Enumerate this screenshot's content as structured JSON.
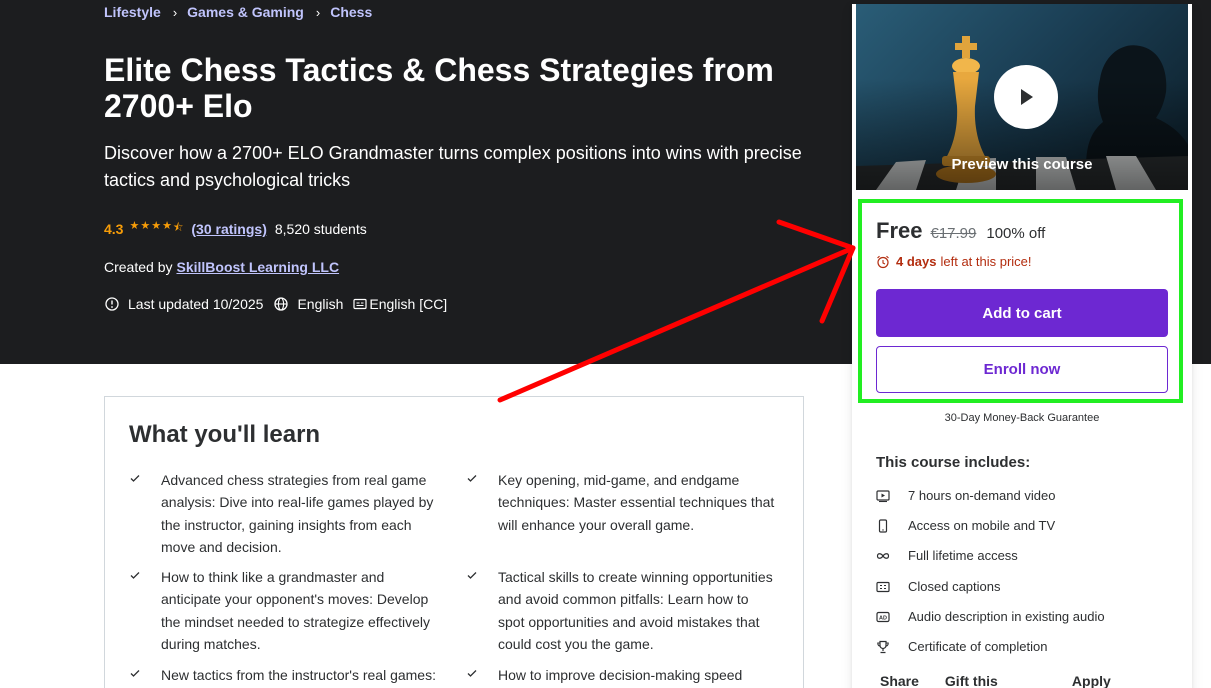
{
  "breadcrumb": {
    "items": [
      "Lifestyle",
      "Games & Gaming",
      "Chess"
    ]
  },
  "course": {
    "title": "Elite Chess Tactics & Chess Strategies from 2700+ Elo",
    "subtitle": "Discover how a 2700+ ELO Grandmaster turns complex positions into wins with precise tactics and psychological tricks",
    "rating": "4.3",
    "stars": 4.3,
    "ratings_count": "(30 ratings)",
    "students": "8,520 students",
    "created_by_prefix": "Created by",
    "author": "SkillBoost Learning LLC",
    "last_updated": "Last updated 10/2025",
    "language": "English",
    "captions": "English [CC]"
  },
  "learn": {
    "title": "What you'll learn",
    "items": [
      "Advanced chess strategies from real game analysis: Dive into real-life games played by the instructor, gaining insights from each move and decision.",
      "Key opening, mid-game, and endgame techniques: Master essential techniques that will enhance your overall game.",
      "How to think like a grandmaster and anticipate your opponent's moves: Develop the mindset needed to strategize effectively during matches.",
      "Tactical skills to create winning opportunities and avoid common pitfalls: Learn how to spot opportunities and avoid mistakes that could cost you the game.",
      "New tactics from the instructor's real games:",
      "How to improve decision-making speed under"
    ]
  },
  "sidebar": {
    "preview_label": "Preview this course",
    "price_free": "Free",
    "price_original": "€17.99",
    "price_discount": "100% off",
    "timer_bold": "4 days",
    "timer_rest": "left at this price!",
    "add_to_cart": "Add to cart",
    "enroll_now": "Enroll now",
    "guarantee": "30-Day Money-Back Guarantee",
    "includes_title": "This course includes:",
    "includes": [
      {
        "icon": "video-icon",
        "label": "7 hours on-demand video"
      },
      {
        "icon": "mobile-icon",
        "label": "Access on mobile and TV"
      },
      {
        "icon": "infinity-icon",
        "label": "Full lifetime access"
      },
      {
        "icon": "closed-captions-icon",
        "label": "Closed captions"
      },
      {
        "icon": "audio-description-icon",
        "label": "Audio description in existing audio"
      },
      {
        "icon": "trophy-icon",
        "label": "Certificate of completion"
      }
    ],
    "links": [
      "Share",
      "Gift this course",
      "Apply Coupon"
    ]
  },
  "colors": {
    "hero_bg": "#1c1d1f",
    "link": "#c0c4fc",
    "star": "#f69c08",
    "primary": "#6d28d2",
    "timer": "#b32d0f",
    "annotation_highlight": "#22ee22",
    "annotation_arrow": "#ff0000"
  }
}
